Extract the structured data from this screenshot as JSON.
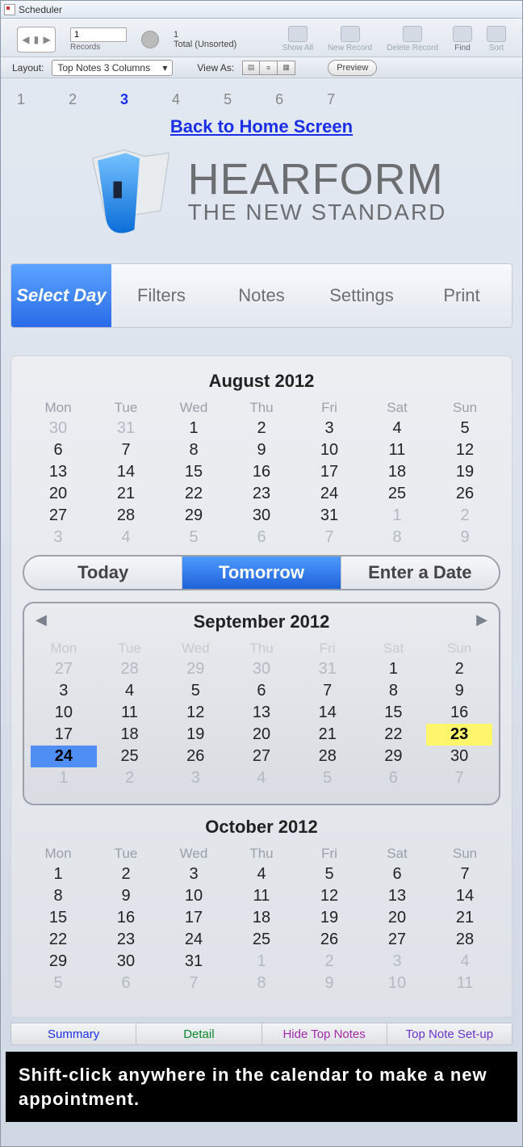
{
  "window": {
    "title": "Scheduler"
  },
  "toolbar": {
    "record_value": "1",
    "records_label": "Records",
    "total_count": "1",
    "total_label": "Total (Unsorted)",
    "show_all": "Show All",
    "new_record": "New Record",
    "delete_record": "Delete Record",
    "find": "Find",
    "sort": "Sort"
  },
  "layoutbar": {
    "layout_label": "Layout:",
    "layout_value": "Top Notes 3 Columns",
    "viewas_label": "View As:",
    "preview": "Preview"
  },
  "number_row": [
    "1",
    "2",
    "3",
    "4",
    "5",
    "6",
    "7"
  ],
  "active_number_index": 2,
  "back_link": "Back to Home Screen",
  "brand": {
    "line1": "HEARFORM",
    "line2": "THE NEW STANDARD"
  },
  "viewtabs": [
    "Select Day",
    "Filters",
    "Notes",
    "Settings",
    "Print"
  ],
  "viewtabs_active": 0,
  "tte": [
    "Today",
    "Tomorrow",
    "Enter a Date"
  ],
  "tte_active": 1,
  "day_names": [
    "Mon",
    "Tue",
    "Wed",
    "Thu",
    "Fri",
    "Sat",
    "Sun"
  ],
  "months": {
    "aug": {
      "title": "August 2012",
      "rows": [
        [
          {
            "n": "30",
            "dim": true
          },
          {
            "n": "31",
            "dim": true
          },
          {
            "n": "1"
          },
          {
            "n": "2"
          },
          {
            "n": "3"
          },
          {
            "n": "4"
          },
          {
            "n": "5"
          }
        ],
        [
          {
            "n": "6"
          },
          {
            "n": "7"
          },
          {
            "n": "8"
          },
          {
            "n": "9"
          },
          {
            "n": "10"
          },
          {
            "n": "11"
          },
          {
            "n": "12"
          }
        ],
        [
          {
            "n": "13"
          },
          {
            "n": "14"
          },
          {
            "n": "15"
          },
          {
            "n": "16"
          },
          {
            "n": "17"
          },
          {
            "n": "18"
          },
          {
            "n": "19"
          }
        ],
        [
          {
            "n": "20"
          },
          {
            "n": "21"
          },
          {
            "n": "22"
          },
          {
            "n": "23"
          },
          {
            "n": "24"
          },
          {
            "n": "25"
          },
          {
            "n": "26"
          }
        ],
        [
          {
            "n": "27"
          },
          {
            "n": "28"
          },
          {
            "n": "29"
          },
          {
            "n": "30"
          },
          {
            "n": "31"
          },
          {
            "n": "1",
            "dim": true
          },
          {
            "n": "2",
            "dim": true
          }
        ],
        [
          {
            "n": "3",
            "dim": true
          },
          {
            "n": "4",
            "dim": true
          },
          {
            "n": "5",
            "dim": true
          },
          {
            "n": "6",
            "dim": true
          },
          {
            "n": "7",
            "dim": true
          },
          {
            "n": "8",
            "dim": true
          },
          {
            "n": "9",
            "dim": true
          }
        ]
      ]
    },
    "sep": {
      "title": "September 2012",
      "rows": [
        [
          {
            "n": "27",
            "dim": true
          },
          {
            "n": "28",
            "dim": true
          },
          {
            "n": "29",
            "dim": true
          },
          {
            "n": "30",
            "dim": true
          },
          {
            "n": "31",
            "dim": true
          },
          {
            "n": "1"
          },
          {
            "n": "2"
          }
        ],
        [
          {
            "n": "3"
          },
          {
            "n": "4"
          },
          {
            "n": "5"
          },
          {
            "n": "6"
          },
          {
            "n": "7"
          },
          {
            "n": "8"
          },
          {
            "n": "9"
          }
        ],
        [
          {
            "n": "10"
          },
          {
            "n": "11"
          },
          {
            "n": "12"
          },
          {
            "n": "13"
          },
          {
            "n": "14"
          },
          {
            "n": "15"
          },
          {
            "n": "16"
          }
        ],
        [
          {
            "n": "17"
          },
          {
            "n": "18"
          },
          {
            "n": "19"
          },
          {
            "n": "20"
          },
          {
            "n": "21"
          },
          {
            "n": "22"
          },
          {
            "n": "23",
            "sel": "yellow"
          }
        ],
        [
          {
            "n": "24",
            "sel": "blue"
          },
          {
            "n": "25"
          },
          {
            "n": "26"
          },
          {
            "n": "27"
          },
          {
            "n": "28"
          },
          {
            "n": "29"
          },
          {
            "n": "30"
          }
        ],
        [
          {
            "n": "1",
            "dim": true
          },
          {
            "n": "2",
            "dim": true
          },
          {
            "n": "3",
            "dim": true
          },
          {
            "n": "4",
            "dim": true
          },
          {
            "n": "5",
            "dim": true
          },
          {
            "n": "6",
            "dim": true
          },
          {
            "n": "7",
            "dim": true
          }
        ]
      ]
    },
    "oct": {
      "title": "October 2012",
      "rows": [
        [
          {
            "n": "1"
          },
          {
            "n": "2"
          },
          {
            "n": "3"
          },
          {
            "n": "4"
          },
          {
            "n": "5"
          },
          {
            "n": "6"
          },
          {
            "n": "7"
          }
        ],
        [
          {
            "n": "8"
          },
          {
            "n": "9"
          },
          {
            "n": "10"
          },
          {
            "n": "11"
          },
          {
            "n": "12"
          },
          {
            "n": "13"
          },
          {
            "n": "14"
          }
        ],
        [
          {
            "n": "15"
          },
          {
            "n": "16"
          },
          {
            "n": "17"
          },
          {
            "n": "18"
          },
          {
            "n": "19"
          },
          {
            "n": "20"
          },
          {
            "n": "21"
          }
        ],
        [
          {
            "n": "22"
          },
          {
            "n": "23"
          },
          {
            "n": "24"
          },
          {
            "n": "25"
          },
          {
            "n": "26"
          },
          {
            "n": "27"
          },
          {
            "n": "28"
          }
        ],
        [
          {
            "n": "29"
          },
          {
            "n": "30"
          },
          {
            "n": "31"
          },
          {
            "n": "1",
            "dim": true
          },
          {
            "n": "2",
            "dim": true
          },
          {
            "n": "3",
            "dim": true
          },
          {
            "n": "4",
            "dim": true
          }
        ],
        [
          {
            "n": "5",
            "dim": true
          },
          {
            "n": "6",
            "dim": true
          },
          {
            "n": "7",
            "dim": true
          },
          {
            "n": "8",
            "dim": true
          },
          {
            "n": "9",
            "dim": true
          },
          {
            "n": "10",
            "dim": true
          },
          {
            "n": "11",
            "dim": true
          }
        ]
      ]
    }
  },
  "bottom_tabs": [
    "Summary",
    "Detail",
    "Hide Top Notes",
    "Top Note Set-up"
  ],
  "tip": "Shift-click anywhere in the calendar to make a new appointment."
}
